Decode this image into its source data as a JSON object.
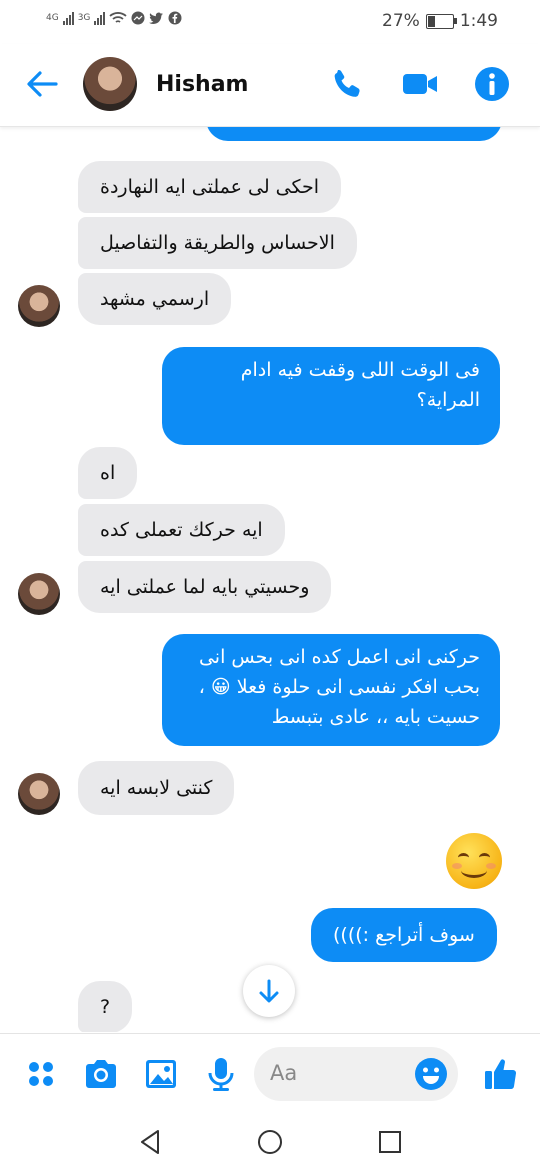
{
  "status_bar": {
    "network_1": "4G",
    "network_2": "3G",
    "battery_percent": "27%",
    "battery_level": 0.27,
    "time": "1:49"
  },
  "header": {
    "contact_name": "Hisham",
    "icons": [
      "back-arrow-icon",
      "phone-icon",
      "video-camera-icon",
      "info-icon"
    ]
  },
  "messages": [
    {
      "side": "in",
      "text": "احكى لى عملتى ايه النهاردة"
    },
    {
      "side": "in",
      "text": "الاحساس والطريقة والتفاصيل"
    },
    {
      "side": "in",
      "text": "ارسمي مشهد"
    },
    {
      "side": "out",
      "lines": [
        "فى الوقت اللى وقفت فيه ادام",
        "المراية؟"
      ]
    },
    {
      "side": "in",
      "text": "اه"
    },
    {
      "side": "in",
      "text": "ايه حركك تعملى كده"
    },
    {
      "side": "in",
      "text": "وحسيتي بايه لما عملتى ايه"
    },
    {
      "side": "out",
      "lines": [
        "حركنى انى اعمل كده انى بحس انى",
        "بحب افكر نفسى انى حلوة فعلا 😀 ،",
        "حسيت بايه ،، عادى بتبسط"
      ]
    },
    {
      "side": "in",
      "text": "كنتى لابسه ايه"
    },
    {
      "side": "out",
      "emoji": "smiling-face-emoji"
    },
    {
      "side": "out",
      "text": "سوف أتراجع  :))))"
    },
    {
      "side": "in",
      "text": "?"
    }
  ],
  "composer": {
    "placeholder": "Aa",
    "icons": [
      "menu-dots-icon",
      "camera-icon",
      "gallery-icon",
      "microphone-icon",
      "emoji-icon",
      "thumbs-up-icon"
    ]
  },
  "colors": {
    "accent": "#0d8cf5",
    "incoming_bubble": "#e9e9eb"
  }
}
